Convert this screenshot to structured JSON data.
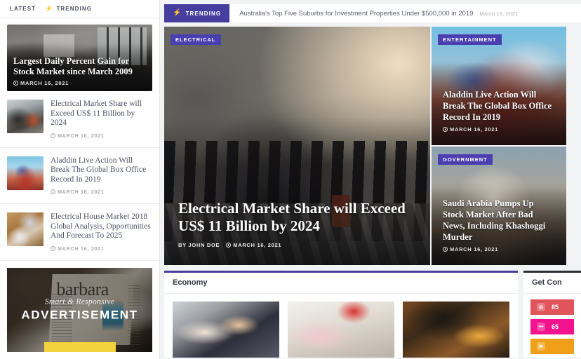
{
  "sidebar": {
    "tabs": [
      {
        "label": "LATEST",
        "icon": ""
      },
      {
        "label": "TRENDING",
        "icon": "bolt-icon"
      }
    ],
    "featured": {
      "title": "Largest Daily Percent Gain for Stock Market since March 2009",
      "date": "MARCH 16, 2021"
    },
    "items": [
      {
        "title": "Electrical Market Share will Exceed US$ 11 Billion by 2024",
        "date": "MARCH 16, 2021"
      },
      {
        "title": "Aladdin Live Action Will Break The Global Box Office Record In 2019",
        "date": "MARCH 16, 2021"
      },
      {
        "title": "Electrical House Market 2018 Global Analysis, Opportunities And Forecast To 2025",
        "date": "MARCH 16, 2021"
      }
    ],
    "ad": {
      "tagline": "Smart & Responsive",
      "title": "ADVERTISEMENT",
      "button_label": "",
      "button_color": "#f2d33f"
    }
  },
  "trending_bar": {
    "badge_label": "TRENDING",
    "badge_icon": "bolt-icon",
    "badge_color": "#463e9e",
    "headline": "Australia's Top Five Suburbs for Investment Properties Under $500,000 in 2019",
    "date": "March 16, 2021"
  },
  "hero": {
    "main": {
      "category": "ELECTRICAL",
      "category_color": "#4b3fb0",
      "title": "Electrical Market Share will Exceed US$ 11 Billion by 2024",
      "author": "BY JOHN DOE",
      "date": "MARCH 16, 2021"
    },
    "side": [
      {
        "category": "ENTERTAINMENT",
        "category_color": "#4b3fb0",
        "title": "Aladdin Live Action Will Break The Global Box Office Record In 2019",
        "date": "MARCH 16, 2021"
      },
      {
        "category": "GOVERNMENT",
        "category_color": "#4b3fb0",
        "title": "Saudi Arabia Pumps Up Stock Market After Bad News, Including Khashoggi Murder",
        "date": "MARCH 16, 2021"
      }
    ]
  },
  "economy": {
    "title": "Economy",
    "accent_color": "#463e9e",
    "cards": [
      {
        "alt": "business-handshake-photo"
      },
      {
        "alt": "retail-store-aisle-photo"
      },
      {
        "alt": "aerial-terrain-photo"
      }
    ]
  },
  "get_connected": {
    "title": "Get Con",
    "accent_color": "#2a2d35",
    "socials": [
      {
        "icon": "instagram-icon",
        "count": "85",
        "color": "#e0545c"
      },
      {
        "icon": "dribbble-icon",
        "count": "65",
        "color": "#f4138e"
      },
      {
        "icon": "rss-icon",
        "count": "",
        "color": "#f0a018"
      }
    ]
  }
}
